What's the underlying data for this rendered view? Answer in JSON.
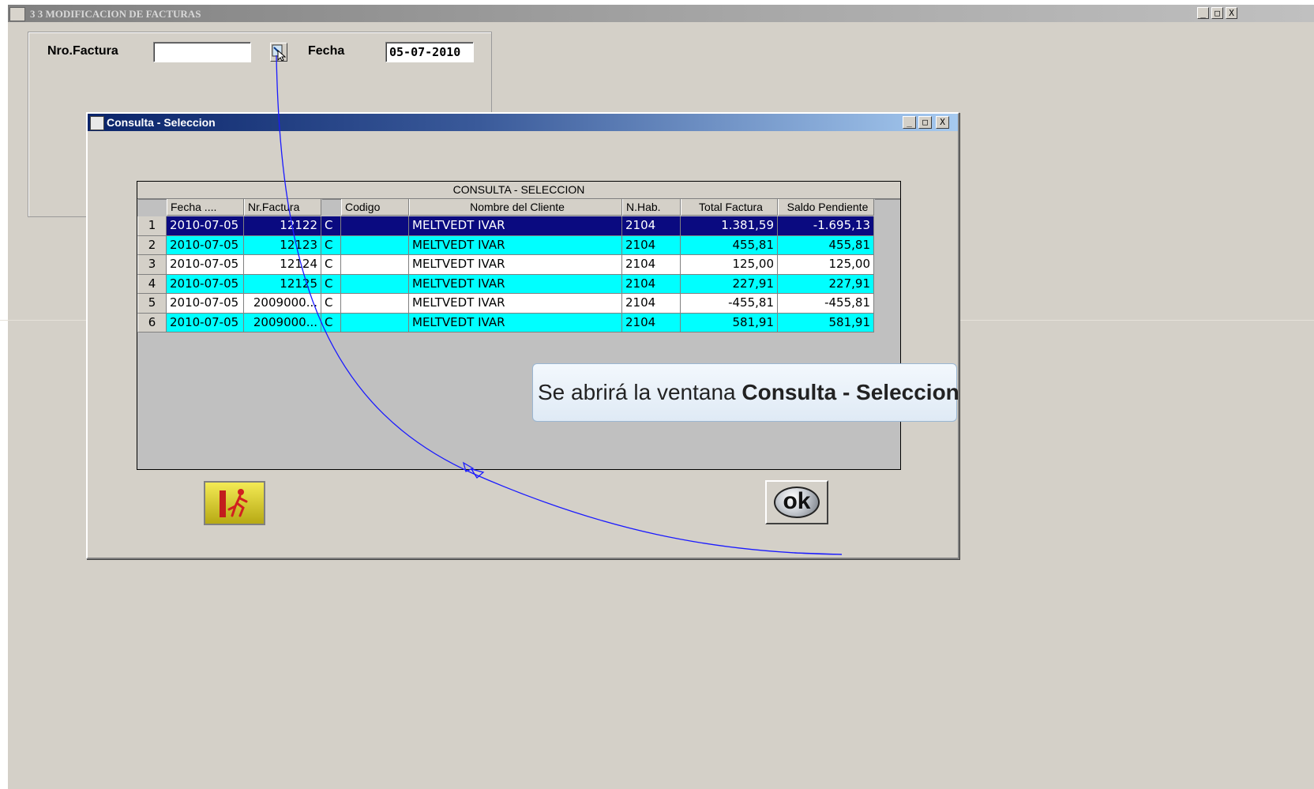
{
  "app": {
    "title": "3 3 MODIFICACION DE FACTURAS",
    "controls": [
      "_",
      "□",
      "X"
    ]
  },
  "form": {
    "nro_factura_label": "Nro.Factura",
    "nro_factura_value": "",
    "fecha_label": "Fecha",
    "fecha_value": "05-07-2010"
  },
  "dialog": {
    "title": "Consulta - Seleccion",
    "controls": [
      "_",
      "□",
      "X"
    ],
    "grid": {
      "caption": "CONSULTA - SELECCION",
      "columns": [
        "Fecha ....",
        "Nr.Factura",
        "",
        "Codigo",
        "Nombre del Cliente",
        "N.Hab.",
        "Total Factura",
        "Saldo Pendiente"
      ],
      "rows": [
        {
          "n": "1",
          "fecha": "2010-07-05",
          "factura": "12122",
          "tipo": "C",
          "codigo": "",
          "cliente": "MELTVEDT IVAR",
          "hab": "2104",
          "total": "1.381,59",
          "saldo": "-1.695,13"
        },
        {
          "n": "2",
          "fecha": "2010-07-05",
          "factura": "12123",
          "tipo": "C",
          "codigo": "",
          "cliente": "MELTVEDT IVAR",
          "hab": "2104",
          "total": "455,81",
          "saldo": "455,81"
        },
        {
          "n": "3",
          "fecha": "2010-07-05",
          "factura": "12124",
          "tipo": "C",
          "codigo": "",
          "cliente": "MELTVEDT IVAR",
          "hab": "2104",
          "total": "125,00",
          "saldo": "125,00"
        },
        {
          "n": "4",
          "fecha": "2010-07-05",
          "factura": "12125",
          "tipo": "C",
          "codigo": "",
          "cliente": "MELTVEDT IVAR",
          "hab": "2104",
          "total": "227,91",
          "saldo": "227,91"
        },
        {
          "n": "5",
          "fecha": "2010-07-05",
          "factura": "2009000...",
          "tipo": "C",
          "codigo": "",
          "cliente": "MELTVEDT IVAR",
          "hab": "2104",
          "total": "-455,81",
          "saldo": "-455,81"
        },
        {
          "n": "6",
          "fecha": "2010-07-05",
          "factura": "2009000...",
          "tipo": "C",
          "codigo": "",
          "cliente": "MELTVEDT IVAR",
          "hab": "2104",
          "total": "581,91",
          "saldo": "581,91"
        }
      ],
      "row_styles": [
        "selected",
        "cyan",
        "white",
        "cyan",
        "white",
        "cyan"
      ]
    },
    "ok_label": "ok",
    "exit_icon": "running-man-exit-icon"
  },
  "callout": {
    "prefix": "Se abrirá la ventana ",
    "bold": "Consulta - Seleccion"
  },
  "colors": {
    "selected_bg": "#0a0a80",
    "cyan_bg": "#00ffff",
    "white_bg": "#ffffff",
    "annotation_line": "#1a1aff"
  }
}
